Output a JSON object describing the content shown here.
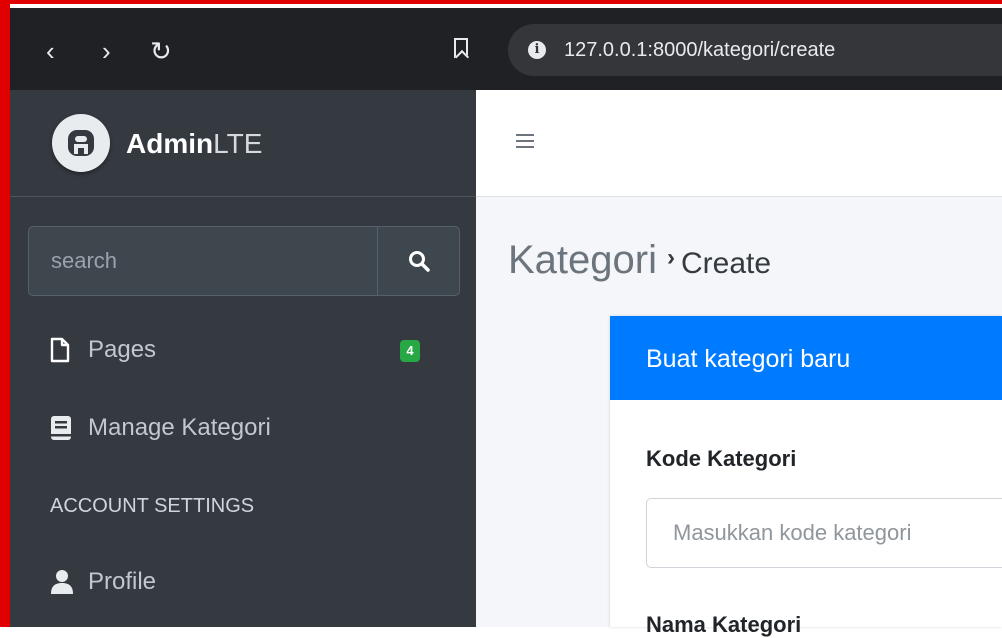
{
  "browser": {
    "url": "127.0.0.1:8000/kategori/create",
    "back_glyph": "‹",
    "forward_glyph": "›",
    "reload_glyph": "↻",
    "info_glyph": "i"
  },
  "sidebar": {
    "brand_bold": "Admin",
    "brand_light": "LTE",
    "search": {
      "placeholder": "search"
    },
    "items": [
      {
        "label": "Pages",
        "icon": "file-icon",
        "badge": "4"
      },
      {
        "label": "Manage Kategori",
        "icon": "book-icon"
      }
    ],
    "section_header": "ACCOUNT SETTINGS",
    "account_items": [
      {
        "label": "Profile",
        "icon": "user-icon"
      }
    ]
  },
  "main": {
    "title": "Kategori",
    "separator": "›",
    "subtitle": "Create",
    "card": {
      "title": "Buat kategori baru",
      "kode_label": "Kode Kategori",
      "kode_placeholder": "Masukkan kode kategori",
      "nama_label": "Nama Kategori"
    }
  },
  "colors": {
    "sidebar": "#343a40",
    "browser": "#202124",
    "primary": "#007bff",
    "badge": "#28a745",
    "frame": "#e00000"
  }
}
